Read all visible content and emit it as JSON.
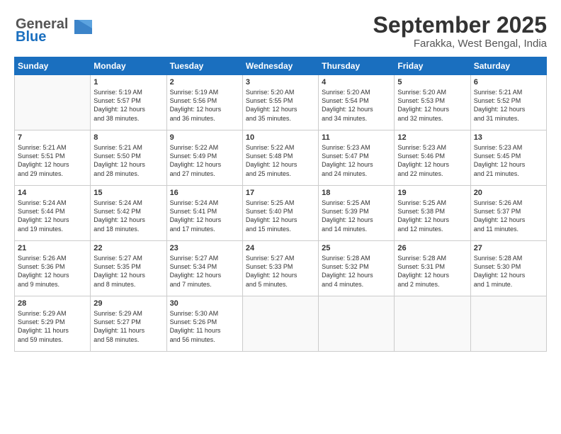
{
  "header": {
    "logo_line1": "General",
    "logo_line2": "Blue",
    "month": "September 2025",
    "location": "Farakka, West Bengal, India"
  },
  "weekdays": [
    "Sunday",
    "Monday",
    "Tuesday",
    "Wednesday",
    "Thursday",
    "Friday",
    "Saturday"
  ],
  "weeks": [
    [
      {
        "day": "",
        "info": ""
      },
      {
        "day": "1",
        "info": "Sunrise: 5:19 AM\nSunset: 5:57 PM\nDaylight: 12 hours\nand 38 minutes."
      },
      {
        "day": "2",
        "info": "Sunrise: 5:19 AM\nSunset: 5:56 PM\nDaylight: 12 hours\nand 36 minutes."
      },
      {
        "day": "3",
        "info": "Sunrise: 5:20 AM\nSunset: 5:55 PM\nDaylight: 12 hours\nand 35 minutes."
      },
      {
        "day": "4",
        "info": "Sunrise: 5:20 AM\nSunset: 5:54 PM\nDaylight: 12 hours\nand 34 minutes."
      },
      {
        "day": "5",
        "info": "Sunrise: 5:20 AM\nSunset: 5:53 PM\nDaylight: 12 hours\nand 32 minutes."
      },
      {
        "day": "6",
        "info": "Sunrise: 5:21 AM\nSunset: 5:52 PM\nDaylight: 12 hours\nand 31 minutes."
      }
    ],
    [
      {
        "day": "7",
        "info": "Sunrise: 5:21 AM\nSunset: 5:51 PM\nDaylight: 12 hours\nand 29 minutes."
      },
      {
        "day": "8",
        "info": "Sunrise: 5:21 AM\nSunset: 5:50 PM\nDaylight: 12 hours\nand 28 minutes."
      },
      {
        "day": "9",
        "info": "Sunrise: 5:22 AM\nSunset: 5:49 PM\nDaylight: 12 hours\nand 27 minutes."
      },
      {
        "day": "10",
        "info": "Sunrise: 5:22 AM\nSunset: 5:48 PM\nDaylight: 12 hours\nand 25 minutes."
      },
      {
        "day": "11",
        "info": "Sunrise: 5:23 AM\nSunset: 5:47 PM\nDaylight: 12 hours\nand 24 minutes."
      },
      {
        "day": "12",
        "info": "Sunrise: 5:23 AM\nSunset: 5:46 PM\nDaylight: 12 hours\nand 22 minutes."
      },
      {
        "day": "13",
        "info": "Sunrise: 5:23 AM\nSunset: 5:45 PM\nDaylight: 12 hours\nand 21 minutes."
      }
    ],
    [
      {
        "day": "14",
        "info": "Sunrise: 5:24 AM\nSunset: 5:44 PM\nDaylight: 12 hours\nand 19 minutes."
      },
      {
        "day": "15",
        "info": "Sunrise: 5:24 AM\nSunset: 5:42 PM\nDaylight: 12 hours\nand 18 minutes."
      },
      {
        "day": "16",
        "info": "Sunrise: 5:24 AM\nSunset: 5:41 PM\nDaylight: 12 hours\nand 17 minutes."
      },
      {
        "day": "17",
        "info": "Sunrise: 5:25 AM\nSunset: 5:40 PM\nDaylight: 12 hours\nand 15 minutes."
      },
      {
        "day": "18",
        "info": "Sunrise: 5:25 AM\nSunset: 5:39 PM\nDaylight: 12 hours\nand 14 minutes."
      },
      {
        "day": "19",
        "info": "Sunrise: 5:25 AM\nSunset: 5:38 PM\nDaylight: 12 hours\nand 12 minutes."
      },
      {
        "day": "20",
        "info": "Sunrise: 5:26 AM\nSunset: 5:37 PM\nDaylight: 12 hours\nand 11 minutes."
      }
    ],
    [
      {
        "day": "21",
        "info": "Sunrise: 5:26 AM\nSunset: 5:36 PM\nDaylight: 12 hours\nand 9 minutes."
      },
      {
        "day": "22",
        "info": "Sunrise: 5:27 AM\nSunset: 5:35 PM\nDaylight: 12 hours\nand 8 minutes."
      },
      {
        "day": "23",
        "info": "Sunrise: 5:27 AM\nSunset: 5:34 PM\nDaylight: 12 hours\nand 7 minutes."
      },
      {
        "day": "24",
        "info": "Sunrise: 5:27 AM\nSunset: 5:33 PM\nDaylight: 12 hours\nand 5 minutes."
      },
      {
        "day": "25",
        "info": "Sunrise: 5:28 AM\nSunset: 5:32 PM\nDaylight: 12 hours\nand 4 minutes."
      },
      {
        "day": "26",
        "info": "Sunrise: 5:28 AM\nSunset: 5:31 PM\nDaylight: 12 hours\nand 2 minutes."
      },
      {
        "day": "27",
        "info": "Sunrise: 5:28 AM\nSunset: 5:30 PM\nDaylight: 12 hours\nand 1 minute."
      }
    ],
    [
      {
        "day": "28",
        "info": "Sunrise: 5:29 AM\nSunset: 5:29 PM\nDaylight: 11 hours\nand 59 minutes."
      },
      {
        "day": "29",
        "info": "Sunrise: 5:29 AM\nSunset: 5:27 PM\nDaylight: 11 hours\nand 58 minutes."
      },
      {
        "day": "30",
        "info": "Sunrise: 5:30 AM\nSunset: 5:26 PM\nDaylight: 11 hours\nand 56 minutes."
      },
      {
        "day": "",
        "info": ""
      },
      {
        "day": "",
        "info": ""
      },
      {
        "day": "",
        "info": ""
      },
      {
        "day": "",
        "info": ""
      }
    ]
  ]
}
